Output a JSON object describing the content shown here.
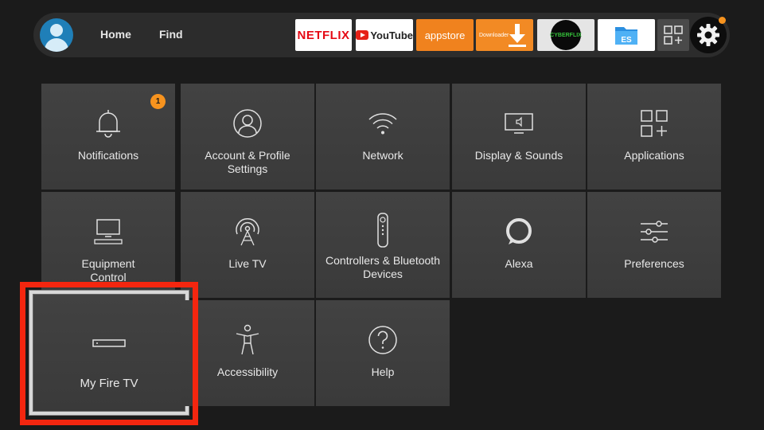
{
  "topbar": {
    "nav": [
      {
        "label": "Home"
      },
      {
        "label": "Find"
      }
    ],
    "apps": [
      {
        "name": "NETFLIX",
        "icon": "netflix-icon"
      },
      {
        "name": "YouTube",
        "icon": "youtube-icon"
      },
      {
        "name": "appstore",
        "icon": "appstore-icon"
      },
      {
        "name": "Downloader",
        "icon": "downloader-icon"
      },
      {
        "name": "CYBERFLIX",
        "icon": "cyberflix-icon"
      },
      {
        "name": "ES",
        "icon": "es-file-explorer-icon"
      },
      {
        "name": "",
        "icon": "all-apps-icon"
      }
    ],
    "settings_icon": "gear-icon",
    "notification_dot_color": "#f7931e"
  },
  "tiles": [
    {
      "label": "Notifications",
      "icon": "bell-icon",
      "badge": "1"
    },
    {
      "label": "Account & Profile\nSettings",
      "icon": "profile-icon"
    },
    {
      "label": "Network",
      "icon": "wifi-icon"
    },
    {
      "label": "Display & Sounds",
      "icon": "display-sound-icon"
    },
    {
      "label": "Applications",
      "icon": "applications-icon"
    },
    {
      "label": "Equipment\nControl",
      "icon": "equipment-icon"
    },
    {
      "label": "Live TV",
      "icon": "antenna-icon"
    },
    {
      "label": "Controllers & Bluetooth\nDevices",
      "icon": "remote-icon"
    },
    {
      "label": "Alexa",
      "icon": "alexa-icon"
    },
    {
      "label": "Preferences",
      "icon": "sliders-icon"
    },
    {
      "label": "My Fire TV",
      "icon": "fire-tv-device-icon",
      "focused": true
    },
    {
      "label": "Accessibility",
      "icon": "accessibility-icon"
    },
    {
      "label": "Help",
      "icon": "help-icon"
    }
  ],
  "colors": {
    "background": "#1b1b1b",
    "tile": "#3f3f3f",
    "accent": "#f7931e",
    "highlight": "#f4260f"
  }
}
